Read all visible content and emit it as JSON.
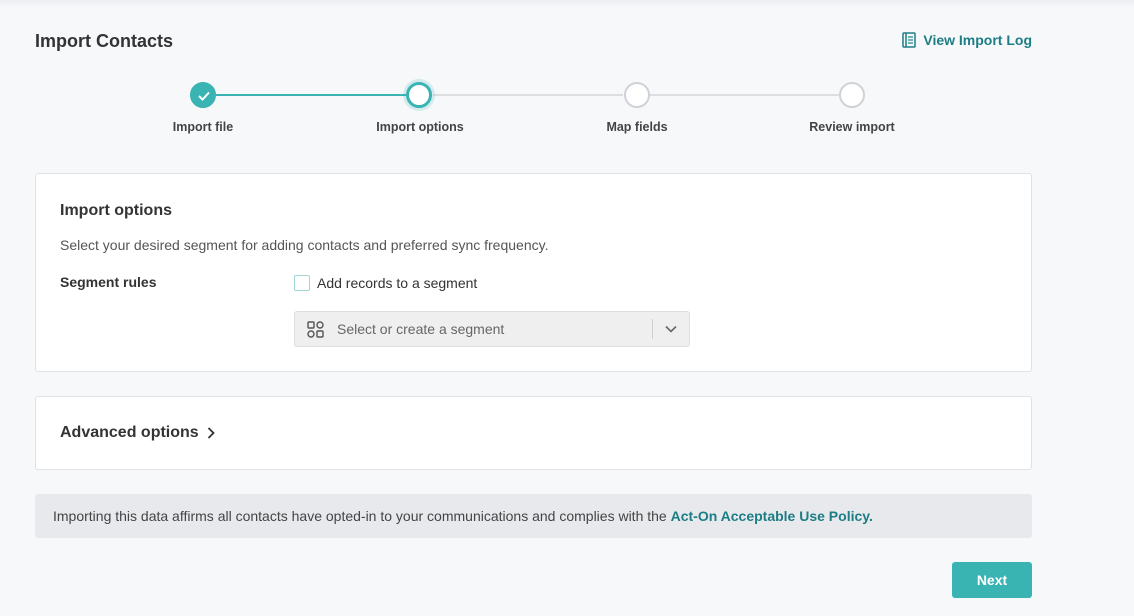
{
  "header": {
    "title": "Import Contacts",
    "log_link": "View Import Log",
    "log_icon": "document-list-icon"
  },
  "stepper": {
    "accent_color": "#3ab3b3",
    "steps": [
      {
        "label": "Import file",
        "state": "complete"
      },
      {
        "label": "Import options",
        "state": "current"
      },
      {
        "label": "Map fields",
        "state": "pending"
      },
      {
        "label": "Review import",
        "state": "pending"
      }
    ]
  },
  "import_options": {
    "title": "Import options",
    "description": "Select your desired segment for adding contacts and preferred sync frequency.",
    "segment_rules_label": "Segment rules",
    "checkbox_label": "Add records to a segment",
    "checkbox_checked": false,
    "segment_select_placeholder": "Select or create a segment",
    "segment_icon": "segment-grid-icon"
  },
  "advanced_options": {
    "title": "Advanced options",
    "expanded": false
  },
  "notice": {
    "text": "Importing this data affirms all contacts have opted-in to your communications and complies with the ",
    "link_text": "Act-On Acceptable Use Policy",
    "suffix": "."
  },
  "footer": {
    "next_label": "Next"
  }
}
